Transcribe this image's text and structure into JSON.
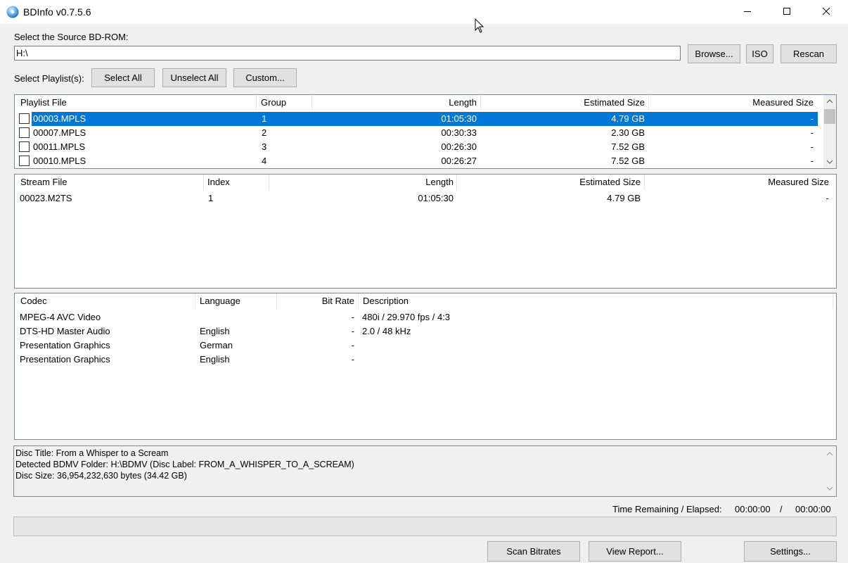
{
  "window": {
    "title": "BDInfo v0.7.5.6",
    "icon": "disc-icon"
  },
  "source": {
    "label": "Select the Source BD-ROM:",
    "path": "H:\\",
    "browse_label": "Browse...",
    "iso_label": "ISO",
    "rescan_label": "Rescan"
  },
  "playlist_controls": {
    "label": "Select Playlist(s):",
    "select_all": "Select All",
    "unselect_all": "Unselect All",
    "custom": "Custom..."
  },
  "playlists": {
    "columns": [
      "Playlist File",
      "Group",
      "Length",
      "Estimated Size",
      "Measured Size"
    ],
    "rows": [
      {
        "file": "00003.MPLS",
        "group": "1",
        "length": "01:05:30",
        "estimated": "4.79 GB",
        "measured": "-",
        "selected": true,
        "checked": false
      },
      {
        "file": "00007.MPLS",
        "group": "2",
        "length": "00:30:33",
        "estimated": "2.30 GB",
        "measured": "-",
        "selected": false,
        "checked": false
      },
      {
        "file": "00011.MPLS",
        "group": "3",
        "length": "00:26:30",
        "estimated": "7.52 GB",
        "measured": "-",
        "selected": false,
        "checked": false
      },
      {
        "file": "00010.MPLS",
        "group": "4",
        "length": "00:26:27",
        "estimated": "7.52 GB",
        "measured": "-",
        "selected": false,
        "checked": false
      }
    ]
  },
  "streams": {
    "columns": [
      "Stream File",
      "Index",
      "Length",
      "Estimated Size",
      "Measured Size"
    ],
    "rows": [
      {
        "file": "00023.M2TS",
        "index": "1",
        "length": "01:05:30",
        "estimated": "4.79 GB",
        "measured": "-"
      }
    ]
  },
  "codecs": {
    "columns": [
      "Codec",
      "Language",
      "Bit Rate",
      "Description"
    ],
    "rows": [
      {
        "codec": "MPEG-4 AVC Video",
        "language": "",
        "bitrate": "-",
        "description": "480i / 29.970 fps / 4:3"
      },
      {
        "codec": "DTS-HD Master Audio",
        "language": "English",
        "bitrate": "-",
        "description": "2.0 / 48 kHz"
      },
      {
        "codec": "Presentation Graphics",
        "language": "German",
        "bitrate": "-",
        "description": ""
      },
      {
        "codec": "Presentation Graphics",
        "language": "English",
        "bitrate": "-",
        "description": ""
      }
    ]
  },
  "disc_info": {
    "lines": [
      "Disc Title: From a Whisper to a Scream",
      "Detected BDMV Folder: H:\\BDMV (Disc Label: FROM_A_WHISPER_TO_A_SCREAM)",
      "Disc Size: 36,954,232,630 bytes (34.42 GB)"
    ]
  },
  "status": {
    "time_label": "Time Remaining / Elapsed:",
    "remaining": "00:00:00",
    "separator": "/",
    "elapsed": "00:00:00",
    "progress": 0
  },
  "actions": {
    "scan_bitrates": "Scan Bitrates",
    "view_report": "View Report...",
    "settings": "Settings..."
  },
  "colors": {
    "selection": "#0078d7",
    "background": "#f0f0f0"
  }
}
